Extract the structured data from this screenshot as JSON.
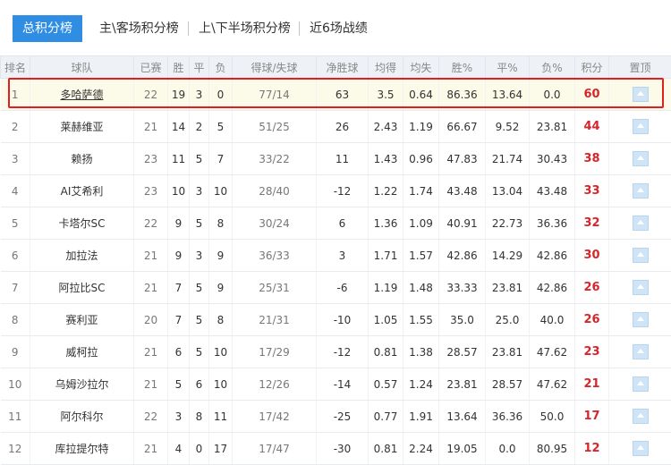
{
  "tabs": [
    {
      "label": "总积分榜",
      "active": true
    },
    {
      "label": "主\\客场积分榜",
      "active": false
    },
    {
      "label": "上\\下半场积分榜",
      "active": false
    },
    {
      "label": "近6场战绩",
      "active": false
    }
  ],
  "headers": [
    "排名",
    "球队",
    "已赛",
    "胜",
    "平",
    "负",
    "得球/失球",
    "净胜球",
    "均得",
    "均失",
    "胜%",
    "平%",
    "负%",
    "积分",
    "置顶"
  ],
  "rows": [
    [
      "1",
      "多哈萨德",
      "22",
      "19",
      "3",
      "0",
      "77/14",
      "63",
      "3.5",
      "0.64",
      "86.36",
      "13.64",
      "0.0",
      "60"
    ],
    [
      "2",
      "莱赫维亚",
      "21",
      "14",
      "2",
      "5",
      "51/25",
      "26",
      "2.43",
      "1.19",
      "66.67",
      "9.52",
      "23.81",
      "44"
    ],
    [
      "3",
      "赖扬",
      "23",
      "11",
      "5",
      "7",
      "33/22",
      "11",
      "1.43",
      "0.96",
      "47.83",
      "21.74",
      "30.43",
      "38"
    ],
    [
      "4",
      "AI艾希利",
      "23",
      "10",
      "3",
      "10",
      "28/40",
      "-12",
      "1.22",
      "1.74",
      "43.48",
      "13.04",
      "43.48",
      "33"
    ],
    [
      "5",
      "卡塔尔SC",
      "22",
      "9",
      "5",
      "8",
      "30/24",
      "6",
      "1.36",
      "1.09",
      "40.91",
      "22.73",
      "36.36",
      "32"
    ],
    [
      "6",
      "加拉法",
      "21",
      "9",
      "3",
      "9",
      "36/33",
      "3",
      "1.71",
      "1.57",
      "42.86",
      "14.29",
      "42.86",
      "30"
    ],
    [
      "7",
      "阿拉比SC",
      "21",
      "7",
      "5",
      "9",
      "25/31",
      "-6",
      "1.19",
      "1.48",
      "33.33",
      "23.81",
      "42.86",
      "26"
    ],
    [
      "8",
      "赛利亚",
      "20",
      "7",
      "5",
      "8",
      "21/31",
      "-10",
      "1.05",
      "1.55",
      "35.0",
      "25.0",
      "40.0",
      "26"
    ],
    [
      "9",
      "威柯拉",
      "21",
      "6",
      "5",
      "10",
      "17/29",
      "-12",
      "0.81",
      "1.38",
      "28.57",
      "23.81",
      "47.62",
      "23"
    ],
    [
      "10",
      "乌姆沙拉尔",
      "21",
      "5",
      "6",
      "10",
      "12/26",
      "-14",
      "0.57",
      "1.24",
      "23.81",
      "28.57",
      "47.62",
      "21"
    ],
    [
      "11",
      "阿尔科尔",
      "22",
      "3",
      "8",
      "11",
      "17/42",
      "-25",
      "0.77",
      "1.91",
      "13.64",
      "36.36",
      "50.0",
      "17"
    ],
    [
      "12",
      "库拉提尔特",
      "21",
      "4",
      "0",
      "17",
      "17/47",
      "-30",
      "0.81",
      "2.24",
      "19.05",
      "0.0",
      "80.95",
      "12"
    ]
  ],
  "colors": {
    "accent": "#2f8de4",
    "points": "#d6262c",
    "highlight_border": "#e02020"
  }
}
